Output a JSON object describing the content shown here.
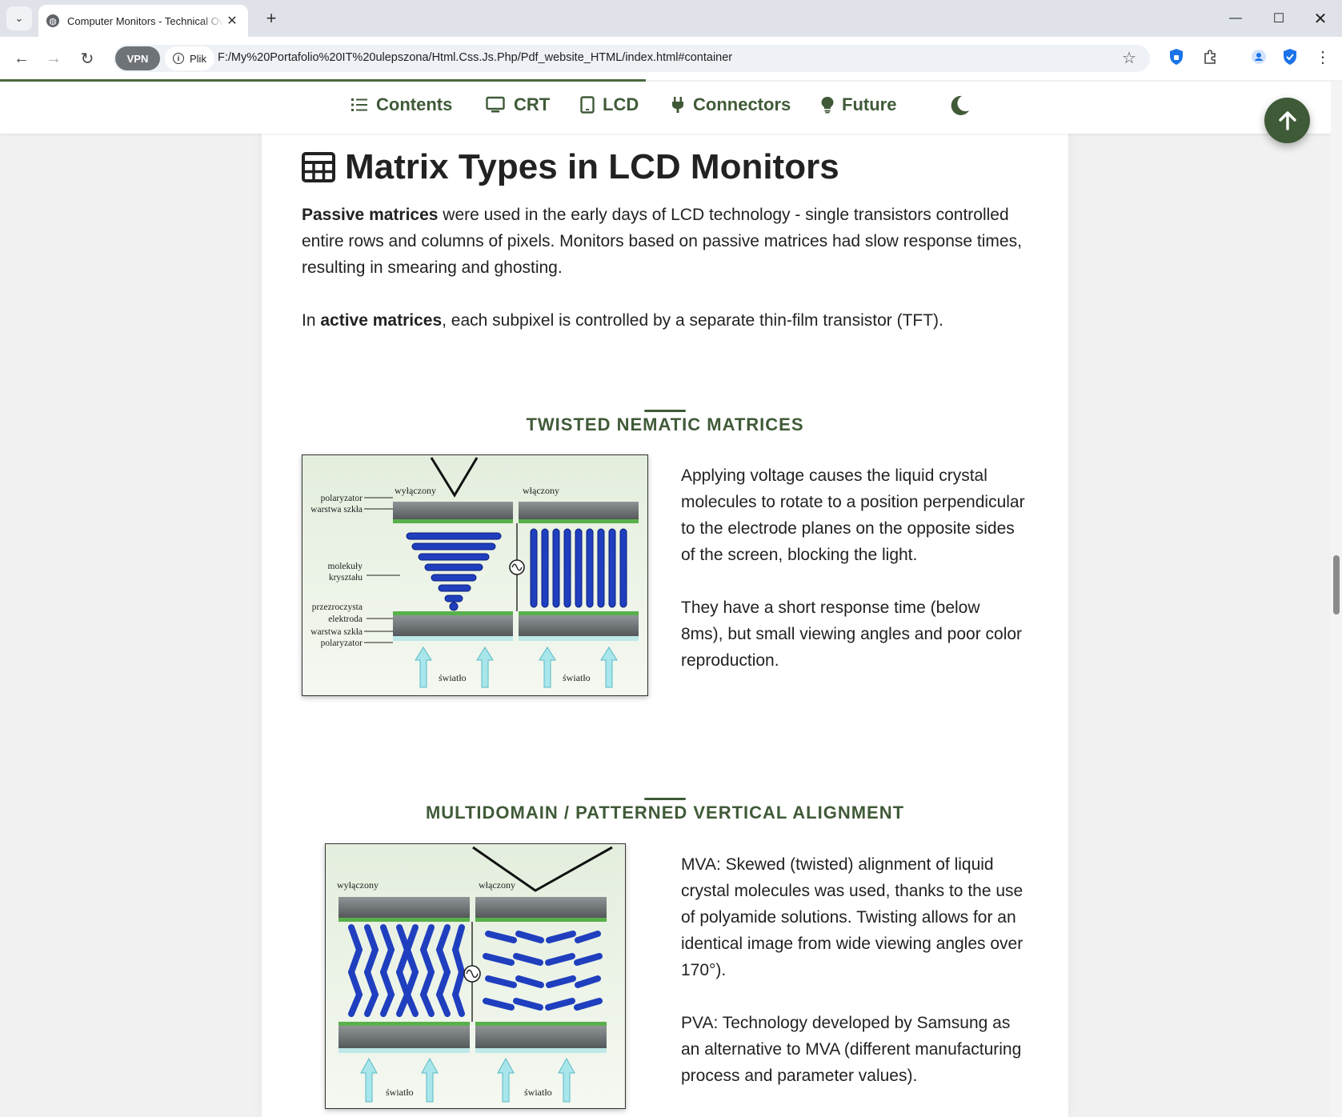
{
  "browser": {
    "tab_title": "Computer Monitors - Technical Ov",
    "url": "F:/My%20Portafolio%20IT%20ulepszona/Html.Css.Js.Php/Pdf_website_HTML/index.html#container",
    "vpn_label": "VPN",
    "site_info_label": "Plik"
  },
  "nav": {
    "items": [
      {
        "label": "Contents",
        "icon": "list-icon"
      },
      {
        "label": "CRT",
        "icon": "monitor-icon"
      },
      {
        "label": "LCD",
        "icon": "tablet-icon"
      },
      {
        "label": "Connectors",
        "icon": "plug-icon"
      },
      {
        "label": "Future",
        "icon": "lightbulb-icon"
      }
    ],
    "theme_icon": "moon-icon",
    "back_to_top_icon": "arrow-up-icon"
  },
  "section": {
    "title": "Matrix Types in LCD Monitors",
    "intro_passive_bold": "Passive matrices",
    "intro_passive_rest": " were used in the early days of LCD technology - single transistors controlled entire rows and columns of pixels. Monitors based on passive matrices had slow response times, resulting in smearing and ghosting.",
    "intro_active_pre": "In ",
    "intro_active_bold": "active matrices",
    "intro_active_rest": ", each subpixel is controlled by a separate thin-film transistor (TFT)."
  },
  "tn": {
    "heading": "TWISTED NEMATIC MATRICES",
    "para1": "Applying voltage causes the liquid crystal molecules to rotate to a position perpendicular to the electrode planes on the opposite sides of the screen, blocking the light.",
    "para2": "They have a short response time (below 8ms), but small viewing angles and poor color reproduction.",
    "figure_labels": {
      "off": "wyłączony",
      "on": "włączony",
      "polarizer": "polaryzator",
      "glass": "warstwa szkła",
      "molecules_1": "molekuły",
      "molecules_2": "kryształu",
      "electrode_1": "przezroczysta",
      "electrode_2": "elektroda",
      "glass_bottom": "warstwa szkła",
      "polarizer_bottom": "polaryzator",
      "light": "światło"
    }
  },
  "mva": {
    "heading": "MULTIDOMAIN / PATTERNED VERTICAL ALIGNMENT",
    "para1": "MVA: Skewed (twisted) alignment of liquid crystal molecules was used, thanks to the use of polyamide solutions. Twisting allows for an identical image from wide viewing angles over 170°).",
    "para2": "PVA: Technology developed by Samsung as an alternative to MVA (different manufacturing process and parameter values).",
    "figure_labels": {
      "off": "wyłączony",
      "on": "włączony",
      "light": "światło"
    }
  },
  "colors": {
    "accent": "#405a38",
    "button": "#3f5a37",
    "crystal": "#1f3fbf",
    "plate": "#6b6f71"
  }
}
